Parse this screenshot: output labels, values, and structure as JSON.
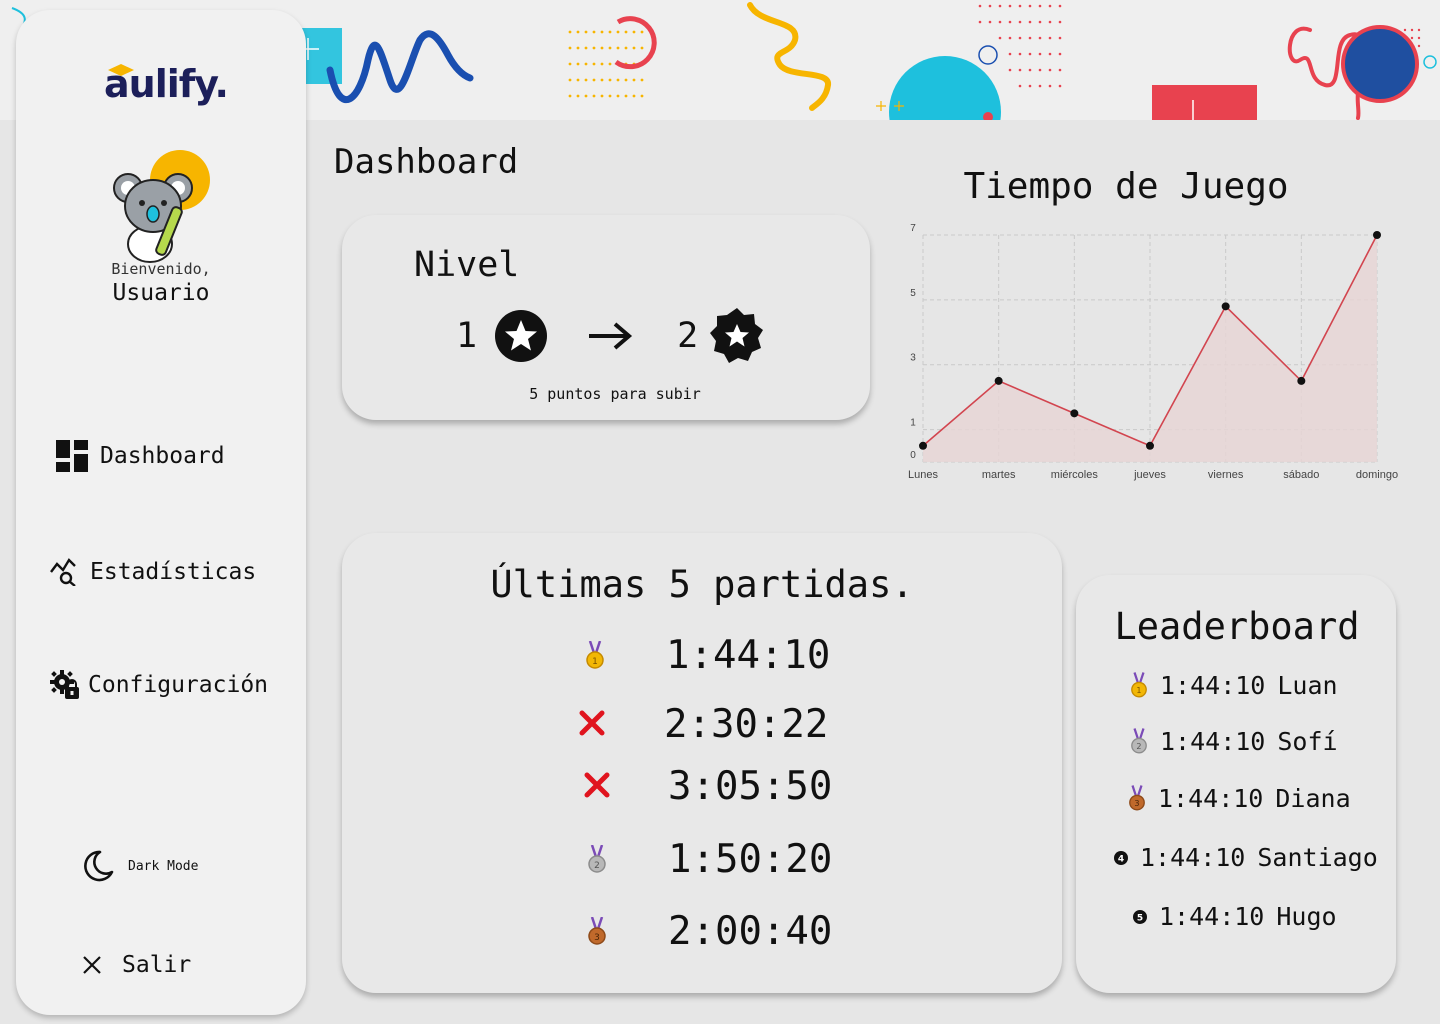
{
  "brand": {
    "logo_text": "aulify."
  },
  "user": {
    "greeting": "Bienvenido,",
    "name": "Usuario"
  },
  "nav": {
    "items": [
      {
        "label": "Dashboard",
        "icon": "dashboard-icon"
      },
      {
        "label": "Estadísticas",
        "icon": "stats-search-icon"
      },
      {
        "label": "Configuración",
        "icon": "settings-lock-icon"
      }
    ],
    "dark_mode_label": "Dark Mode",
    "logout_label": "Salir"
  },
  "page": {
    "title": "Dashboard"
  },
  "level": {
    "title": "Nivel",
    "current": "1",
    "next": "2",
    "hint": "5 puntos para subir"
  },
  "chart_data": {
    "type": "area",
    "title": "Tiempo de Juego",
    "categories": [
      "Lunes",
      "martes",
      "miércoles",
      "jueves",
      "viernes",
      "sábado",
      "domingo"
    ],
    "values": [
      0.5,
      2.5,
      1.5,
      0.5,
      4.8,
      2.5,
      7
    ],
    "yticks": [
      0,
      1,
      3,
      5,
      7
    ],
    "ylim": [
      0,
      7
    ],
    "grid": true,
    "colors": {
      "line": "#d2454f",
      "fill": "#e6d5d5",
      "point": "#111111"
    }
  },
  "recent_games": {
    "title": "Últimas 5 partidas.",
    "items": [
      {
        "time": "1:44:10",
        "icon": "gold-medal-icon"
      },
      {
        "time": "2:30:22",
        "icon": "red-x-icon"
      },
      {
        "time": "3:05:50",
        "icon": "red-x-icon"
      },
      {
        "time": "1:50:20",
        "icon": "silver-medal-icon"
      },
      {
        "time": "2:00:40",
        "icon": "bronze-medal-icon"
      }
    ]
  },
  "leaderboard": {
    "title": "Leaderboard",
    "items": [
      {
        "time": "1:44:10",
        "name": "Luan",
        "icon": "gold-medal-icon"
      },
      {
        "time": "1:44:10",
        "name": "Sofí",
        "icon": "silver-medal-icon"
      },
      {
        "time": "1:44:10",
        "name": "Diana",
        "icon": "bronze-medal-icon"
      },
      {
        "time": "1:44:10",
        "name": "Santiago",
        "icon": "rank-4-icon"
      },
      {
        "time": "1:44:10",
        "name": "Hugo",
        "icon": "rank-5-icon"
      }
    ]
  },
  "theme": {
    "accent_red": "#e8424f",
    "accent_blue": "#1ec0dd",
    "brand_navy": "#1c1f5a",
    "brand_yellow": "#f7b500"
  }
}
